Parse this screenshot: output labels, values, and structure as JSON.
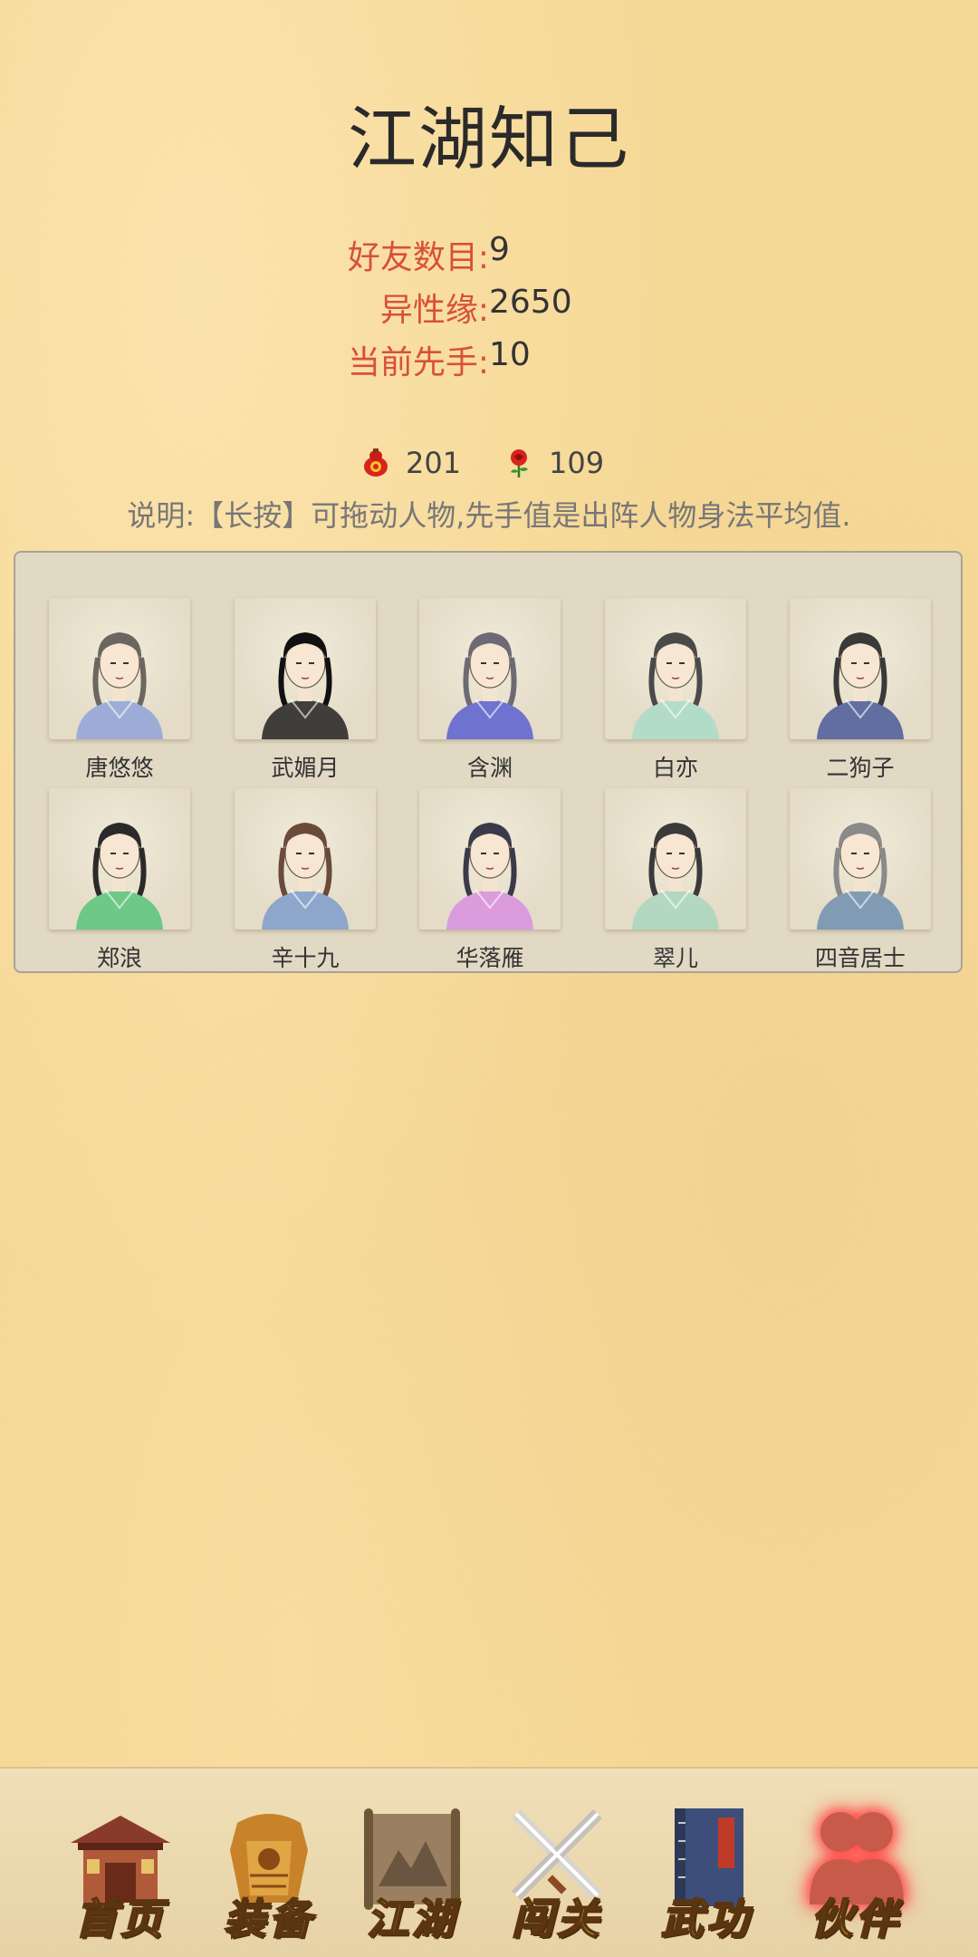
{
  "title": "江湖知己",
  "stats": [
    {
      "label": "好友数目:",
      "value": "9"
    },
    {
      "label": "异性缘:",
      "value": "2650"
    },
    {
      "label": "当前先手:",
      "value": "10"
    }
  ],
  "currency": [
    {
      "icon": "red-gourd-icon",
      "value": "201"
    },
    {
      "icon": "red-rose-icon",
      "value": "109"
    }
  ],
  "note": "说明:【长按】可拖动人物,先手值是出阵人物身法平均值.",
  "characters": [
    {
      "name": "唐悠悠",
      "robe": "#8fa3d8",
      "hair": "#6b6660"
    },
    {
      "name": "武媚月",
      "robe": "#222222",
      "hair": "#111111"
    },
    {
      "name": "含渊",
      "robe": "#5a5fd0",
      "hair": "#6d6a76"
    },
    {
      "name": "白亦",
      "robe": "#a8dcc8",
      "hair": "#4a4a4a"
    },
    {
      "name": "二狗子",
      "robe": "#4a5a9a",
      "hair": "#3a3a3a"
    },
    {
      "name": "郑浪",
      "robe": "#58c47a",
      "hair": "#2a2a2a"
    },
    {
      "name": "辛十九",
      "robe": "#7f9ccc",
      "hair": "#6a4a3a"
    },
    {
      "name": "华落雁",
      "robe": "#d88fe0",
      "hair": "#3a3a4a"
    },
    {
      "name": "翠儿",
      "robe": "#a9d6c0",
      "hair": "#3a3a3a"
    },
    {
      "name": "四音居士",
      "robe": "#6f8fb0",
      "hair": "#8a8a8a"
    }
  ],
  "nav": [
    {
      "label": "首页",
      "icon": "house-icon"
    },
    {
      "label": "装备",
      "icon": "armor-icon"
    },
    {
      "label": "江湖",
      "icon": "scroll-map-icon"
    },
    {
      "label": "闯关",
      "icon": "crossed-swords-icon"
    },
    {
      "label": "武功",
      "icon": "martial-book-icon"
    },
    {
      "label": "伙伴",
      "icon": "companions-icon",
      "active": true
    }
  ],
  "colors": {
    "background": "#f6d896",
    "stat_label": "#d8503a",
    "nav_label": "#f2c230"
  }
}
